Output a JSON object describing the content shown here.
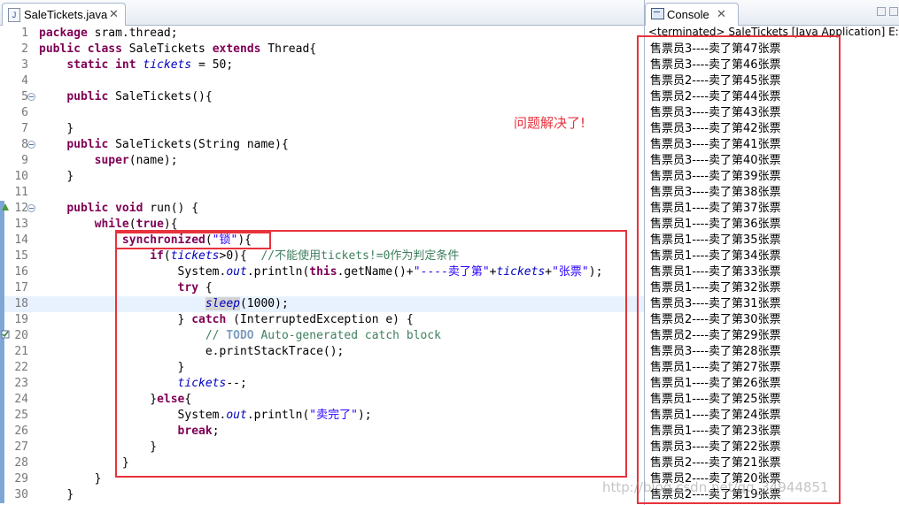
{
  "editor": {
    "tab_name": "SaleTickets.java",
    "tab_icon": "java-file-icon",
    "annotation": "问题解决了!",
    "lines": [
      {
        "n": "1"
      },
      {
        "n": "2"
      },
      {
        "n": "3"
      },
      {
        "n": "4"
      },
      {
        "n": "5"
      },
      {
        "n": "6"
      },
      {
        "n": "7"
      },
      {
        "n": "8"
      },
      {
        "n": "9"
      },
      {
        "n": "10"
      },
      {
        "n": "11"
      },
      {
        "n": "12"
      },
      {
        "n": "13"
      },
      {
        "n": "14"
      },
      {
        "n": "15"
      },
      {
        "n": "16"
      },
      {
        "n": "17"
      },
      {
        "n": "18"
      },
      {
        "n": "19"
      },
      {
        "n": "20"
      },
      {
        "n": "21"
      },
      {
        "n": "22"
      },
      {
        "n": "23"
      },
      {
        "n": "24"
      },
      {
        "n": "25"
      },
      {
        "n": "26"
      },
      {
        "n": "27"
      },
      {
        "n": "28"
      },
      {
        "n": "29"
      },
      {
        "n": "30"
      }
    ],
    "tokens": {
      "l1": [
        "package",
        " sram.thread;"
      ],
      "l2": [
        "public",
        "class",
        " SaleTickets ",
        "extends",
        " Thread{"
      ],
      "l3": [
        "static",
        "int",
        "tickets",
        " = 50;"
      ],
      "l5": [
        "public",
        " SaleTickets(){"
      ],
      "l7": [
        "}"
      ],
      "l8": [
        "public",
        " SaleTickets(String name){"
      ],
      "l9": [
        "super",
        "(name);"
      ],
      "l10": [
        "}"
      ],
      "l12": [
        "public",
        "void",
        " run() {"
      ],
      "l13": [
        "while",
        "(",
        "true",
        "){"
      ],
      "l14": [
        "synchronized",
        "(",
        "\"锁\"",
        "){"
      ],
      "l15": [
        "if",
        "(",
        "tickets",
        ">0){  ",
        "//不能使用tickets!=0作为判定条件"
      ],
      "l16": [
        "System.",
        "out",
        ".println(",
        "this",
        ".getName()+",
        "\"----卖了第\"",
        "+",
        "tickets",
        "+",
        "\"张票\"",
        ");"
      ],
      "l17": [
        "try",
        " {"
      ],
      "l18": [
        "sleep",
        "(1000);"
      ],
      "l19": [
        "} ",
        "catch",
        " (InterruptedException e) {"
      ],
      "l20": [
        "// ",
        "TODO",
        " Auto-generated catch block"
      ],
      "l21": [
        "e.printStackTrace();"
      ],
      "l22": [
        "}"
      ],
      "l23": [
        "tickets",
        "--;"
      ],
      "l24": [
        "}",
        "else",
        "{"
      ],
      "l25": [
        "System.",
        "out",
        ".println(",
        "\"卖完了\"",
        ");"
      ],
      "l26": [
        "break",
        ";"
      ],
      "l27": [
        "}"
      ],
      "l28": [
        "}"
      ],
      "l29": [
        "}"
      ],
      "l30": [
        "}"
      ]
    }
  },
  "console": {
    "tab_name": "Console",
    "status": "<terminated> SaleTickets [Java Application] E:\\M",
    "output": [
      "售票员3----卖了第47张票",
      "售票员3----卖了第46张票",
      "售票员2----卖了第45张票",
      "售票员2----卖了第44张票",
      "售票员3----卖了第43张票",
      "售票员3----卖了第42张票",
      "售票员3----卖了第41张票",
      "售票员3----卖了第40张票",
      "售票员3----卖了第39张票",
      "售票员3----卖了第38张票",
      "售票员1----卖了第37张票",
      "售票员1----卖了第36张票",
      "售票员1----卖了第35张票",
      "售票员1----卖了第34张票",
      "售票员1----卖了第33张票",
      "售票员1----卖了第32张票",
      "售票员3----卖了第31张票",
      "售票员2----卖了第30张票",
      "售票员2----卖了第29张票",
      "售票员3----卖了第28张票",
      "售票员1----卖了第27张票",
      "售票员1----卖了第26张票",
      "售票员1----卖了第25张票",
      "售票员1----卖了第24张票",
      "售票员1----卖了第23张票",
      "售票员3----卖了第22张票",
      "售票员2----卖了第21张票",
      "售票员2----卖了第20张票",
      "售票员2----卖了第19张票"
    ]
  },
  "watermark": "http://blog.csdn.net/qq_34944851"
}
